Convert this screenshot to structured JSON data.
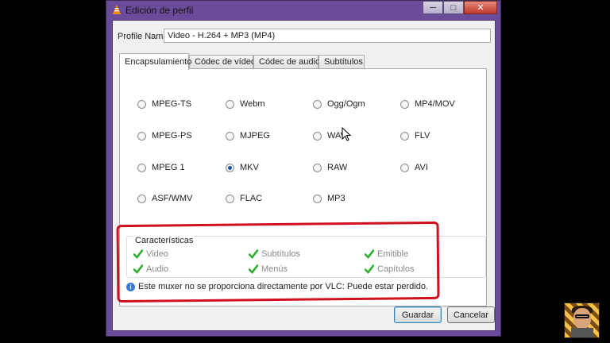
{
  "window": {
    "title": "Edición de perfil",
    "app_icon": "vlc-cone-icon",
    "controls": [
      "minimize-icon",
      "maximize-icon",
      "close-icon"
    ]
  },
  "profile": {
    "label": "Profile Name",
    "value": "Video - H.264 + MP3 (MP4)"
  },
  "tabs": [
    {
      "label": "Encapsulamiento",
      "active": true
    },
    {
      "label": "Códec de vídeo",
      "active": false
    },
    {
      "label": "Códec de audio",
      "active": false
    },
    {
      "label": "Subtítulos",
      "active": false
    }
  ],
  "formats": [
    {
      "label": "MPEG-TS",
      "selected": false
    },
    {
      "label": "Webm",
      "selected": false
    },
    {
      "label": "Ogg/Ogm",
      "selected": false
    },
    {
      "label": "MP4/MOV",
      "selected": false
    },
    {
      "label": "MPEG-PS",
      "selected": false
    },
    {
      "label": "MJPEG",
      "selected": false
    },
    {
      "label": "WAV",
      "selected": false
    },
    {
      "label": "FLV",
      "selected": false
    },
    {
      "label": "MPEG 1",
      "selected": false
    },
    {
      "label": "MKV",
      "selected": true
    },
    {
      "label": "RAW",
      "selected": false
    },
    {
      "label": "AVI",
      "selected": false
    },
    {
      "label": "ASF/WMV",
      "selected": false
    },
    {
      "label": "FLAC",
      "selected": false
    },
    {
      "label": "MP3",
      "selected": false
    }
  ],
  "features": {
    "title": "Características",
    "items": [
      {
        "label": "Video"
      },
      {
        "label": "Subtítulos"
      },
      {
        "label": "Emitible"
      },
      {
        "label": "Audio"
      },
      {
        "label": "Menús"
      },
      {
        "label": "Capítulos"
      }
    ]
  },
  "info": {
    "text": "Este muxer no se proporciona directamente por VLC: Puede estar perdido."
  },
  "buttons": {
    "save": "Guardar",
    "cancel": "Cancelar"
  },
  "colors": {
    "frame": "#6b4c9a",
    "check": "#2fae2f",
    "annotation": "#d0111e"
  }
}
